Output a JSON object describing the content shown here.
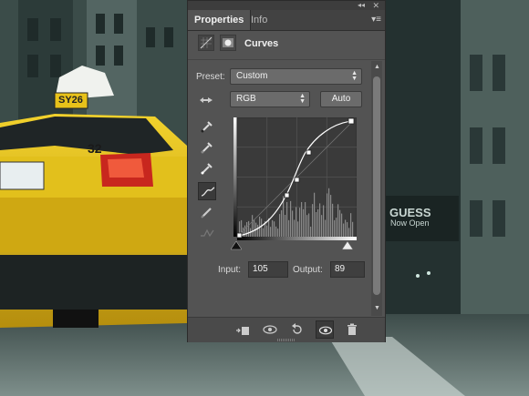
{
  "background": {
    "taxi_roof_sign": "SY26",
    "taxi_number": "32",
    "store_sign": "GUESS",
    "store_sub": "Now Open"
  },
  "panel": {
    "tabs": [
      {
        "label": "Properties",
        "active": true
      },
      {
        "label": "Info",
        "active": false
      }
    ],
    "adjustment_title": "Curves",
    "preset_label": "Preset:",
    "preset_value": "Custom",
    "channel_value": "RGB",
    "auto_label": "Auto",
    "input_label": "Input:",
    "input_value": "105",
    "output_label": "Output:",
    "output_value": "89",
    "icons": {
      "collapse": "double-chevron-icon",
      "close": "close-icon",
      "menu": "panel-menu-icon"
    }
  },
  "colors": {
    "panel_bg": "#535353",
    "tab_bar": "#424242",
    "taxi_yellow": "#e8c21a"
  }
}
